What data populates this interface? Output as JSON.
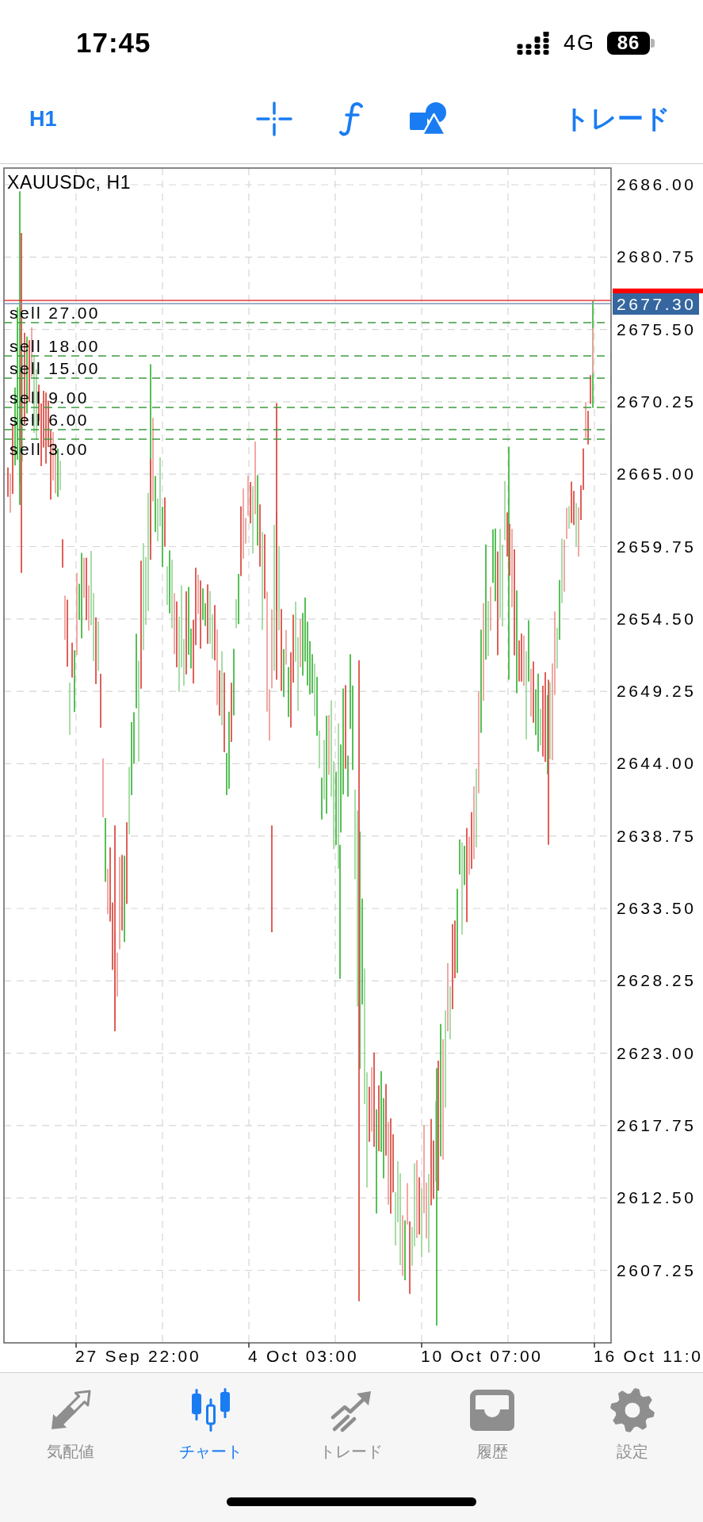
{
  "status_bar": {
    "time": "17:45",
    "network": "4G",
    "battery": "86"
  },
  "toolbar": {
    "timeframe": "H1",
    "trade_button": "トレード"
  },
  "chart": {
    "symbol": "XAUUSDc, H1",
    "price_axis": [
      "2686.00",
      "2680.75",
      "2675.50",
      "2670.25",
      "2665.00",
      "2659.75",
      "2654.50",
      "2649.25",
      "2644.00",
      "2638.75",
      "2633.50",
      "2628.25",
      "2623.00",
      "2617.75",
      "2612.50",
      "2607.25"
    ],
    "current_price": "2677.30",
    "orders": [
      {
        "label": "sell 27.00"
      },
      {
        "label": "sell 18.00"
      },
      {
        "label": "sell 15.00"
      },
      {
        "label": "sell 9.00"
      },
      {
        "label": "sell 6.00"
      },
      {
        "label": "sell 3.00"
      }
    ],
    "time_axis": [
      "27 Sep 22:00",
      "4 Oct 03:00",
      "10 Oct 07:00",
      "16 Oct 11:0"
    ]
  },
  "tab_bar": {
    "tabs": [
      {
        "label": "気配値",
        "selected": false
      },
      {
        "label": "チャート",
        "selected": true
      },
      {
        "label": "トレード",
        "selected": false
      },
      {
        "label": "履歴",
        "selected": false
      },
      {
        "label": "設定",
        "selected": false
      }
    ]
  }
}
